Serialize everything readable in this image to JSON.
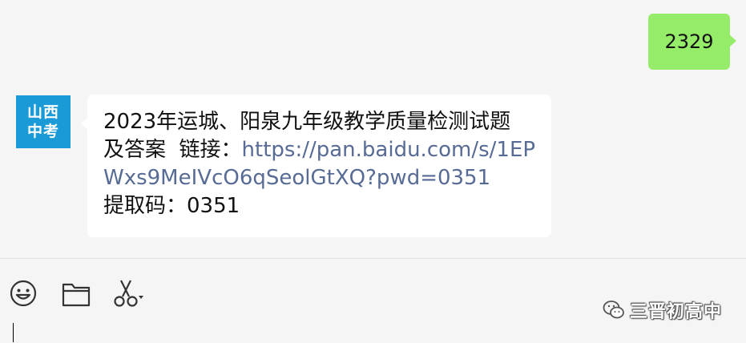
{
  "outgoing_message": {
    "text": "2329",
    "bubble_color": "#95ec69"
  },
  "incoming_message": {
    "sender_avatar": {
      "line1": "山西",
      "line2": "中考",
      "color": "#1a9ad6"
    },
    "line1": "2023年运城、阳泉九年级教学质量检测试题",
    "line2_prefix": "及答案  链接：",
    "link": "https://pan.baidu.com/s/1EPWxs9MeIVcO6qSeolGtXQ?pwd=0351",
    "line_code": "提取码：0351",
    "link_color": "#576b95"
  },
  "toolbar": {
    "icons": [
      "emoji-icon",
      "folder-icon",
      "scissors-icon"
    ]
  },
  "watermark": {
    "icon": "wechat-icon",
    "text": "三晋初高中"
  }
}
